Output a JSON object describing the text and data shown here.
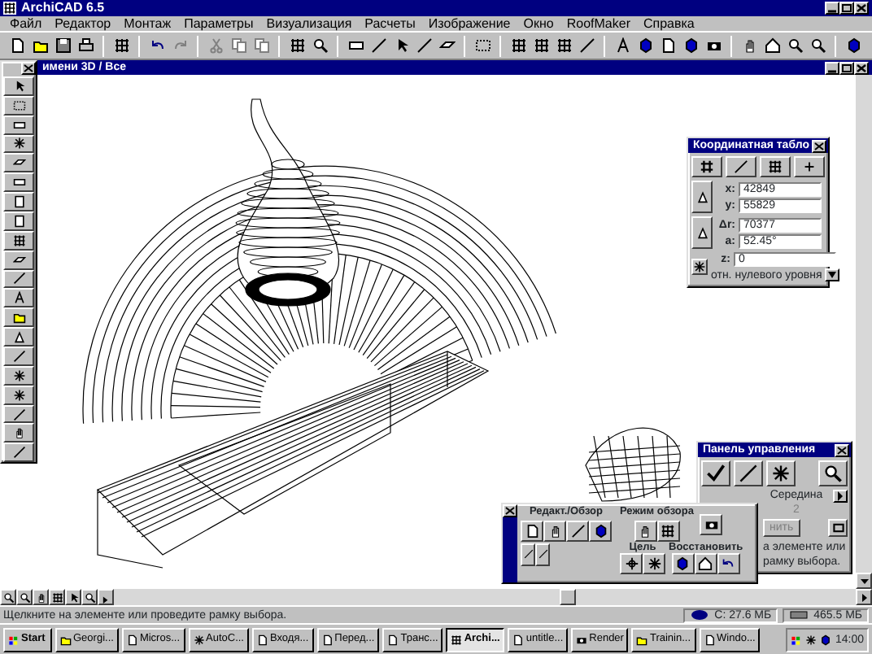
{
  "app_window": {
    "title": "ArchiCAD 6.5"
  },
  "menu": [
    "Файл",
    "Редактор",
    "Монтаж",
    "Параметры",
    "Визуализация",
    "Расчеты",
    "Изображение",
    "Окно",
    "RoofMaker",
    "Справка"
  ],
  "document": {
    "title": "имени 3D / Все"
  },
  "coordinate_palette": {
    "title": "Координатная табло",
    "fields": [
      {
        "label": "x:",
        "value": "42849"
      },
      {
        "label": "y:",
        "value": "55829"
      },
      {
        "label": "Δr:",
        "value": "70377"
      },
      {
        "label": "a:",
        "value": "52.45°"
      },
      {
        "label": "z:",
        "value": "0"
      }
    ],
    "reference": "отн. нулевого уровня"
  },
  "control_palette": {
    "title": "Панель управления",
    "snap_mode": "Середина",
    "snap_value": "2",
    "button": "нить",
    "hint_lines": [
      "а элементе или",
      "рамку выбора."
    ]
  },
  "navigator_palette": {
    "edit_view": "Редакт./Обзор",
    "view_mode": "Режим обзора",
    "target": "Цель",
    "restore": "Восстановить"
  },
  "status_bar": {
    "message": "Щелкните на элементе или проведите рамку выбора.",
    "memory": "С: 27.6 МБ",
    "disk": "465.5 МБ"
  },
  "taskbar": {
    "start": "Start",
    "tasks": [
      {
        "label": "Georgi...",
        "selected": false
      },
      {
        "label": "Micros...",
        "selected": false
      },
      {
        "label": "AutoC...",
        "selected": false
      },
      {
        "label": "Входя...",
        "selected": false
      },
      {
        "label": "Перед...",
        "selected": false
      },
      {
        "label": "Транс...",
        "selected": false
      },
      {
        "label": "Archi...",
        "selected": true
      },
      {
        "label": "untitle...",
        "selected": false
      },
      {
        "label": "Render",
        "selected": false
      },
      {
        "label": "Trainin...",
        "selected": false
      },
      {
        "label": "Windo...",
        "selected": false
      }
    ],
    "clock": "14:00"
  }
}
